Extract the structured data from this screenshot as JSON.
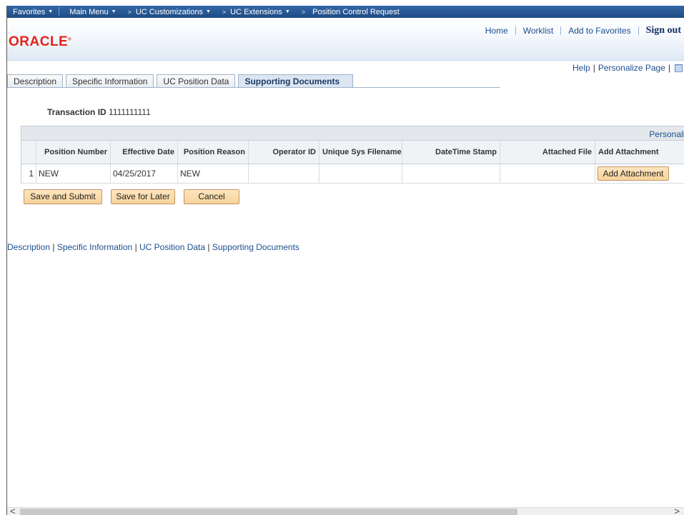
{
  "nav": {
    "favorites": "Favorites",
    "main_menu": "Main Menu",
    "crumbs": [
      "UC Customizations",
      "UC Extensions",
      "Position Control Request"
    ]
  },
  "header": {
    "logo": "ORACLE",
    "links": [
      "Home",
      "Worklist",
      "Add to Favorites"
    ],
    "sign_out": "Sign out"
  },
  "helpbar": {
    "help": "Help",
    "personalize_page": "Personalize Page"
  },
  "tabs": [
    "Description",
    "Specific Information",
    "UC Position Data",
    "Supporting Documents"
  ],
  "active_tab": "Supporting Documents",
  "transaction": {
    "label": "Transaction ID",
    "value": "1111111111"
  },
  "grid": {
    "personalize": "Personalize",
    "columns": [
      "",
      "Position Number",
      "Effective Date",
      "Position Reason",
      "Operator ID",
      "Unique Sys Filename",
      "DateTime Stamp",
      "Attached File",
      "Add Attachment"
    ],
    "rows": [
      {
        "row_num": "1",
        "position_number": "NEW",
        "effective_date": "04/25/2017",
        "position_reason": "NEW",
        "operator_id": "",
        "unique_sys_filename": "",
        "datetime_stamp": "",
        "attached_file": "",
        "add_attachment_button": "Add Attachment"
      }
    ]
  },
  "actions": {
    "save_submit": "Save and Submit",
    "save_later": "Save for Later",
    "cancel": "Cancel"
  },
  "bottom_links": [
    "Description",
    "Specific Information",
    "UC Position Data",
    "Supporting Documents"
  ],
  "colors": {
    "nav_bg": "#1f4e88",
    "oracle_red": "#e2231a",
    "link_blue": "#1c4f8e",
    "button_bg": "#f8d39a"
  }
}
